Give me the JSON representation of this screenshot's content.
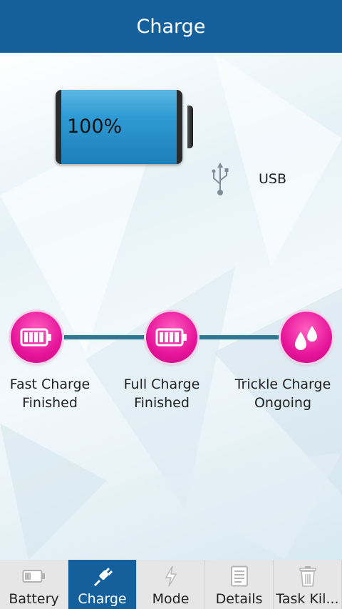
{
  "header": {
    "title": "Charge"
  },
  "battery": {
    "percent_label": "100%",
    "level": 1.0,
    "source_label": "USB"
  },
  "stages": [
    {
      "line1": "Fast Charge",
      "line2": "Finished",
      "icon": "battery-full-icon"
    },
    {
      "line1": "Full Charge",
      "line2": "Finished",
      "icon": "battery-full-icon"
    },
    {
      "line1": "Trickle Charge",
      "line2": "Ongoing",
      "icon": "droplets-icon"
    }
  ],
  "nav": [
    {
      "label": "Battery",
      "icon": "battery-icon",
      "active": false
    },
    {
      "label": "Charge",
      "icon": "plug-icon",
      "active": true
    },
    {
      "label": "Mode",
      "icon": "lightning-icon",
      "active": false
    },
    {
      "label": "Details",
      "icon": "document-icon",
      "active": false
    },
    {
      "label": "Task Kil...",
      "icon": "trash-icon",
      "active": false
    }
  ],
  "colors": {
    "header": "#14609c",
    "stage_accent": "#e6149a",
    "track": "#2e7891",
    "battery_fill": "#2f9bd4"
  }
}
